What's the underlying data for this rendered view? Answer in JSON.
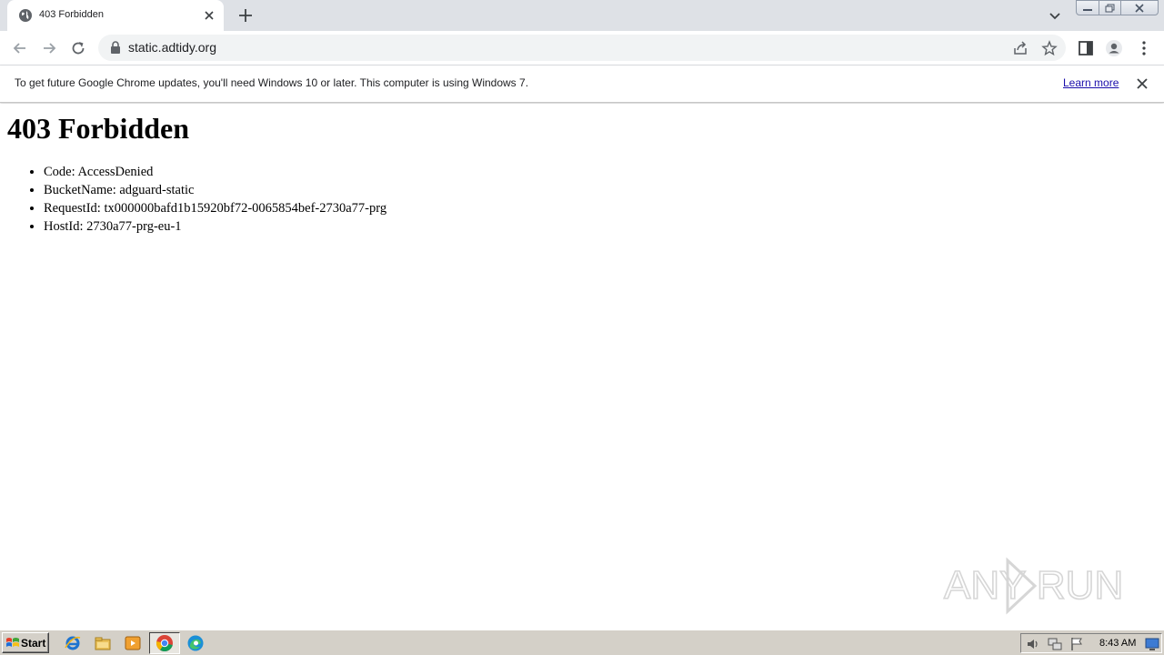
{
  "tab": {
    "title": "403 Forbidden"
  },
  "address_bar": {
    "url": "static.adtidy.org"
  },
  "infobar": {
    "message": "To get future Google Chrome updates, you'll need Windows 10 or later. This computer is using Windows 7.",
    "link_label": "Learn more"
  },
  "page": {
    "heading": "403 Forbidden",
    "items": [
      "Code: AccessDenied",
      "BucketName: adguard-static",
      "RequestId: tx000000bafd1b15920bf72-0065854bef-2730a77-prg",
      "HostId: 2730a77-prg-eu-1"
    ]
  },
  "watermark": {
    "text": "ANY RUN"
  },
  "taskbar": {
    "start_label": "Start",
    "clock": "8:43 AM"
  },
  "colors": {
    "link": "#1a0dab",
    "tabstrip": "#dee1e6",
    "omnibox": "#f1f3f4",
    "taskbar": "#d4d0c8"
  }
}
